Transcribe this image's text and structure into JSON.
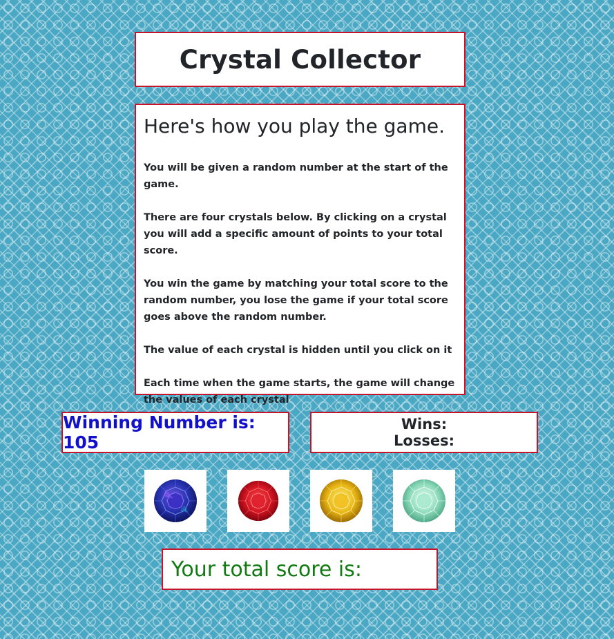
{
  "header": {
    "title": "Crystal Collector"
  },
  "instructions": {
    "heading": "Here's how you play the game.",
    "paragraphs": [
      "You will be given a random number at the start of the game.",
      "There are four crystals below. By clicking on a crystal you will add a specific amount of points to your total score.",
      "You win the game by matching your total score to the random number, you lose the game if your total score goes above the random number.",
      "The value of each crystal is hidden until you click on it",
      "Each time when the game starts, the game will change the values of each crystal"
    ]
  },
  "winning": {
    "text": "Winning Number is: 105"
  },
  "stats": {
    "wins_label": "Wins:",
    "losses_label": "Losses:"
  },
  "crystals": [
    {
      "name": "blue-crystal-icon",
      "color": "#2a35b8"
    },
    {
      "name": "red-crystal-icon",
      "color": "#d01422"
    },
    {
      "name": "yellow-crystal-icon",
      "color": "#e8b514"
    },
    {
      "name": "green-crystal-icon",
      "color": "#8fdcbc"
    }
  ],
  "score": {
    "label": "Your total score is:"
  },
  "colors": {
    "background": "#4aa8c4",
    "border": "#c8142b",
    "winning_text": "#1111cc",
    "score_text": "#127a12"
  }
}
